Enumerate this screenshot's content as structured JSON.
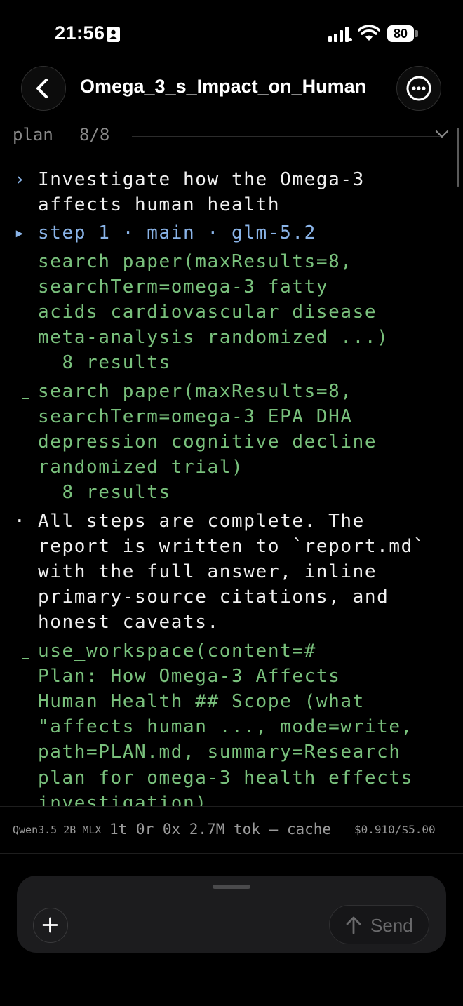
{
  "status_bar": {
    "time": "21:56",
    "battery": "80"
  },
  "header": {
    "title": "Omega_3_s_Impact_on_Human",
    "back_icon": "chevron-left-icon",
    "more_icon": "ellipsis-circle-icon"
  },
  "plan": {
    "label": "plan",
    "count": "8/8"
  },
  "log": {
    "prompt": {
      "marker": "›",
      "lines": [
        "Investigate how the Omega-3",
        "affects human health"
      ]
    },
    "step": {
      "marker": "▸",
      "text": "step 1 · main · glm-5.2"
    },
    "tool_call_1": {
      "lines": [
        "search_paper(maxResults=8,",
        "searchTerm=omega-3 fatty",
        "acids cardiovascular disease",
        "meta-analysis randomized ...)"
      ],
      "result": "  8 results"
    },
    "tool_call_2": {
      "lines": [
        "search_paper(maxResults=8,",
        "searchTerm=omega-3 EPA DHA",
        "depression cognitive decline",
        "randomized trial)"
      ],
      "result": "  8 results"
    },
    "message": {
      "marker": "·",
      "lines": [
        "All steps are complete. The",
        "report is written to `report.md`",
        "with the full answer, inline",
        "primary-source citations, and",
        "honest caveats."
      ]
    },
    "tool_call_3": {
      "lines": [
        "use_workspace(content=#",
        "Plan: How Omega-3 Affects",
        "Human Health ## Scope (what",
        "\"affects human ..., mode=write,",
        "path=PLAN.md, summary=Research",
        "plan for omega-3 health effects",
        "investigation)"
      ]
    }
  },
  "stats": {
    "model": "Qwen3.5 2B MLX",
    "counts": "1t 0r 0x 2.7M tok — cache",
    "cost": "$0.910/$5.00"
  },
  "composer": {
    "add_icon": "plus-icon",
    "send_label": "Send",
    "send_icon": "arrow-up-icon"
  },
  "colors": {
    "prompt": "#f0f0f0",
    "step": "#8ab4e8",
    "tool": "#79c07c",
    "background": "#000000"
  }
}
